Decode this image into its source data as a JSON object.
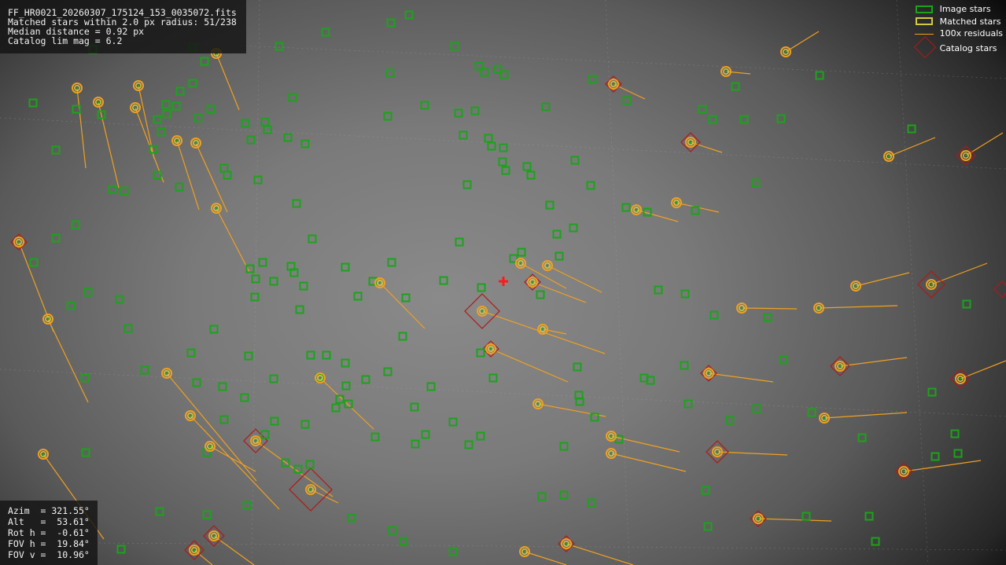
{
  "info": {
    "line1": "FF_HR0021_20260307_175124_153_0035072.fits",
    "line2": "Matched stars within 2.0 px radius: 51/238",
    "line3": "Median distance = 0.92 px",
    "line4": "Catalog lim mag = 6.2"
  },
  "pointing": {
    "azim": "Azim  = 321.55°",
    "alt": "Alt   =  53.61°",
    "rot": "Rot h =  -0.61°",
    "fov_h": "FOV h =  19.84°",
    "fov_v": "FOV v =  10.96°"
  },
  "legend": {
    "image_stars": "Image stars",
    "matched_stars": "Matched stars",
    "residuals": "100x residuals",
    "catalog_stars": "Catalog stars"
  },
  "colors": {
    "image_star": "#1aa31a",
    "matched_ring": "#f0a020",
    "matched_inner": "#d6c840",
    "residual": "#f0a020",
    "catalog": "#b01818",
    "center_marker": "#ff1a1a"
  },
  "icons": {
    "center": "red-cross-icon"
  },
  "image_stars": [
    [
      118,
      63
    ],
    [
      245,
      60
    ],
    [
      260,
      78
    ],
    [
      355,
      59
    ],
    [
      414,
      41
    ],
    [
      497,
      29
    ],
    [
      520,
      19
    ],
    [
      578,
      59
    ],
    [
      496,
      93
    ],
    [
      609,
      84
    ],
    [
      616,
      92
    ],
    [
      633,
      88
    ],
    [
      641,
      95
    ],
    [
      42,
      131
    ],
    [
      97,
      139
    ],
    [
      129,
      146
    ],
    [
      211,
      133
    ],
    [
      224,
      135
    ],
    [
      200,
      152
    ],
    [
      212,
      145
    ],
    [
      205,
      168
    ],
    [
      195,
      190
    ],
    [
      245,
      106
    ],
    [
      229,
      116
    ],
    [
      268,
      139
    ],
    [
      252,
      150
    ],
    [
      312,
      157
    ],
    [
      337,
      155
    ],
    [
      340,
      165
    ],
    [
      319,
      178
    ],
    [
      366,
      175
    ],
    [
      388,
      183
    ],
    [
      372,
      124
    ],
    [
      493,
      148
    ],
    [
      540,
      134
    ],
    [
      583,
      144
    ],
    [
      604,
      141
    ],
    [
      589,
      172
    ],
    [
      621,
      176
    ],
    [
      625,
      186
    ],
    [
      640,
      188
    ],
    [
      639,
      206
    ],
    [
      643,
      217
    ],
    [
      670,
      212
    ],
    [
      675,
      223
    ],
    [
      694,
      136
    ],
    [
      731,
      204
    ],
    [
      751,
      236
    ],
    [
      753,
      101
    ],
    [
      797,
      128
    ],
    [
      893,
      139
    ],
    [
      906,
      152
    ],
    [
      946,
      152
    ],
    [
      993,
      151
    ],
    [
      935,
      110
    ],
    [
      1042,
      96
    ],
    [
      1159,
      164
    ],
    [
      71,
      191
    ],
    [
      143,
      241
    ],
    [
      158,
      243
    ],
    [
      200,
      223
    ],
    [
      228,
      238
    ],
    [
      285,
      214
    ],
    [
      289,
      223
    ],
    [
      328,
      229
    ],
    [
      377,
      259
    ],
    [
      397,
      304
    ],
    [
      96,
      286
    ],
    [
      71,
      303
    ],
    [
      43,
      334
    ],
    [
      594,
      235
    ],
    [
      699,
      261
    ],
    [
      708,
      298
    ],
    [
      729,
      290
    ],
    [
      796,
      264
    ],
    [
      823,
      270
    ],
    [
      884,
      268
    ],
    [
      961,
      233
    ],
    [
      584,
      308
    ],
    [
      318,
      342
    ],
    [
      334,
      334
    ],
    [
      325,
      355
    ],
    [
      348,
      358
    ],
    [
      370,
      339
    ],
    [
      374,
      347
    ],
    [
      386,
      364
    ],
    [
      324,
      378
    ],
    [
      381,
      394
    ],
    [
      439,
      340
    ],
    [
      455,
      377
    ],
    [
      474,
      358
    ],
    [
      498,
      334
    ],
    [
      516,
      379
    ],
    [
      564,
      357
    ],
    [
      612,
      366
    ],
    [
      663,
      321
    ],
    [
      653,
      329
    ],
    [
      711,
      326
    ],
    [
      687,
      375
    ],
    [
      112,
      372
    ],
    [
      152,
      381
    ],
    [
      90,
      389
    ],
    [
      163,
      418
    ],
    [
      272,
      419
    ],
    [
      243,
      449
    ],
    [
      316,
      453
    ],
    [
      395,
      452
    ],
    [
      415,
      452
    ],
    [
      439,
      462
    ],
    [
      493,
      473
    ],
    [
      465,
      483
    ],
    [
      440,
      491
    ],
    [
      406,
      481
    ],
    [
      348,
      482
    ],
    [
      283,
      492
    ],
    [
      250,
      487
    ],
    [
      184,
      471
    ],
    [
      108,
      481
    ],
    [
      512,
      428
    ],
    [
      611,
      449
    ],
    [
      627,
      481
    ],
    [
      548,
      492
    ],
    [
      527,
      518
    ],
    [
      432,
      508
    ],
    [
      443,
      514
    ],
    [
      427,
      519
    ],
    [
      477,
      556
    ],
    [
      541,
      553
    ],
    [
      528,
      565
    ],
    [
      576,
      537
    ],
    [
      611,
      555
    ],
    [
      596,
      566
    ],
    [
      734,
      467
    ],
    [
      736,
      503
    ],
    [
      737,
      511
    ],
    [
      756,
      531
    ],
    [
      787,
      559
    ],
    [
      717,
      568
    ],
    [
      837,
      369
    ],
    [
      871,
      374
    ],
    [
      908,
      401
    ],
    [
      976,
      404
    ],
    [
      870,
      465
    ],
    [
      819,
      481
    ],
    [
      827,
      484
    ],
    [
      875,
      514
    ],
    [
      928,
      535
    ],
    [
      962,
      520
    ],
    [
      996,
      458
    ],
    [
      1032,
      525
    ],
    [
      1096,
      557
    ],
    [
      1185,
      499
    ],
    [
      1229,
      387
    ],
    [
      285,
      534
    ],
    [
      311,
      506
    ],
    [
      349,
      536
    ],
    [
      388,
      540
    ],
    [
      337,
      553
    ],
    [
      263,
      576
    ],
    [
      109,
      576
    ],
    [
      363,
      589
    ],
    [
      379,
      597
    ],
    [
      394,
      591
    ],
    [
      203,
      651
    ],
    [
      263,
      655
    ],
    [
      314,
      643
    ],
    [
      447,
      659
    ],
    [
      499,
      675
    ],
    [
      513,
      689
    ],
    [
      576,
      702
    ],
    [
      689,
      632
    ],
    [
      717,
      630
    ],
    [
      752,
      640
    ],
    [
      154,
      699
    ],
    [
      897,
      624
    ],
    [
      900,
      670
    ],
    [
      1025,
      657
    ],
    [
      1105,
      657
    ],
    [
      1113,
      689
    ],
    [
      1189,
      581
    ],
    [
      1214,
      552
    ],
    [
      1218,
      577
    ]
  ],
  "matched_stars": [
    [
      98,
      112,
      109,
      214
    ],
    [
      125,
      130,
      151,
      239
    ],
    [
      176,
      109,
      196,
      202
    ],
    [
      172,
      137,
      208,
      232
    ],
    [
      225,
      179,
      253,
      267
    ],
    [
      249,
      182,
      289,
      270
    ],
    [
      275,
      68,
      304,
      140
    ],
    [
      275,
      265,
      318,
      348
    ],
    [
      24,
      308,
      68,
      422
    ],
    [
      61,
      406,
      112,
      512
    ],
    [
      55,
      578,
      132,
      686
    ],
    [
      212,
      475,
      326,
      612
    ],
    [
      242,
      529,
      355,
      648
    ],
    [
      267,
      568,
      325,
      600
    ],
    [
      325,
      561,
      423,
      632
    ],
    [
      395,
      623,
      430,
      640
    ],
    [
      407,
      481,
      475,
      546
    ],
    [
      483,
      360,
      540,
      418
    ],
    [
      613,
      396,
      769,
      450
    ],
    [
      624,
      444,
      722,
      486
    ],
    [
      662,
      335,
      720,
      367
    ],
    [
      696,
      338,
      765,
      372
    ],
    [
      677,
      359,
      745,
      385
    ],
    [
      690,
      419,
      720,
      425
    ],
    [
      684,
      514,
      770,
      530
    ],
    [
      777,
      555,
      864,
      575
    ],
    [
      777,
      577,
      872,
      600
    ],
    [
      780,
      107,
      820,
      126
    ],
    [
      809,
      267,
      862,
      282
    ],
    [
      860,
      258,
      914,
      270
    ],
    [
      878,
      181,
      918,
      194
    ],
    [
      923,
      91,
      954,
      94
    ],
    [
      999,
      66,
      1041,
      40
    ],
    [
      1130,
      199,
      1189,
      175
    ],
    [
      1228,
      198,
      1275,
      169
    ],
    [
      943,
      392,
      1013,
      393
    ],
    [
      1041,
      392,
      1141,
      389
    ],
    [
      1088,
      364,
      1156,
      347
    ],
    [
      1184,
      362,
      1255,
      335
    ],
    [
      901,
      475,
      983,
      486
    ],
    [
      1068,
      466,
      1153,
      455
    ],
    [
      1221,
      482,
      1279,
      459
    ],
    [
      1048,
      532,
      1153,
      525
    ],
    [
      912,
      575,
      1001,
      579
    ],
    [
      964,
      660,
      1057,
      663
    ],
    [
      1149,
      600,
      1247,
      586
    ],
    [
      667,
      702,
      720,
      719
    ],
    [
      720,
      692,
      805,
      719
    ],
    [
      272,
      682,
      323,
      719
    ],
    [
      247,
      700,
      270,
      719
    ]
  ],
  "catalog_stars": [
    [
      878,
      181,
      12
    ],
    [
      780,
      107,
      10
    ],
    [
      1228,
      198,
      12
    ],
    [
      1184,
      362,
      17
    ],
    [
      1274,
      368,
      10
    ],
    [
      613,
      396,
      22
    ],
    [
      677,
      359,
      10
    ],
    [
      624,
      444,
      10
    ],
    [
      325,
      561,
      15
    ],
    [
      395,
      623,
      27
    ],
    [
      272,
      682,
      13
    ],
    [
      247,
      700,
      12
    ],
    [
      912,
      575,
      14
    ],
    [
      1068,
      466,
      12
    ],
    [
      1149,
      600,
      11
    ],
    [
      1221,
      482,
      12
    ],
    [
      720,
      692,
      10
    ],
    [
      964,
      660,
      10
    ],
    [
      901,
      475,
      10
    ],
    [
      24,
      308,
      10
    ]
  ],
  "center_marker": [
    640,
    358
  ]
}
